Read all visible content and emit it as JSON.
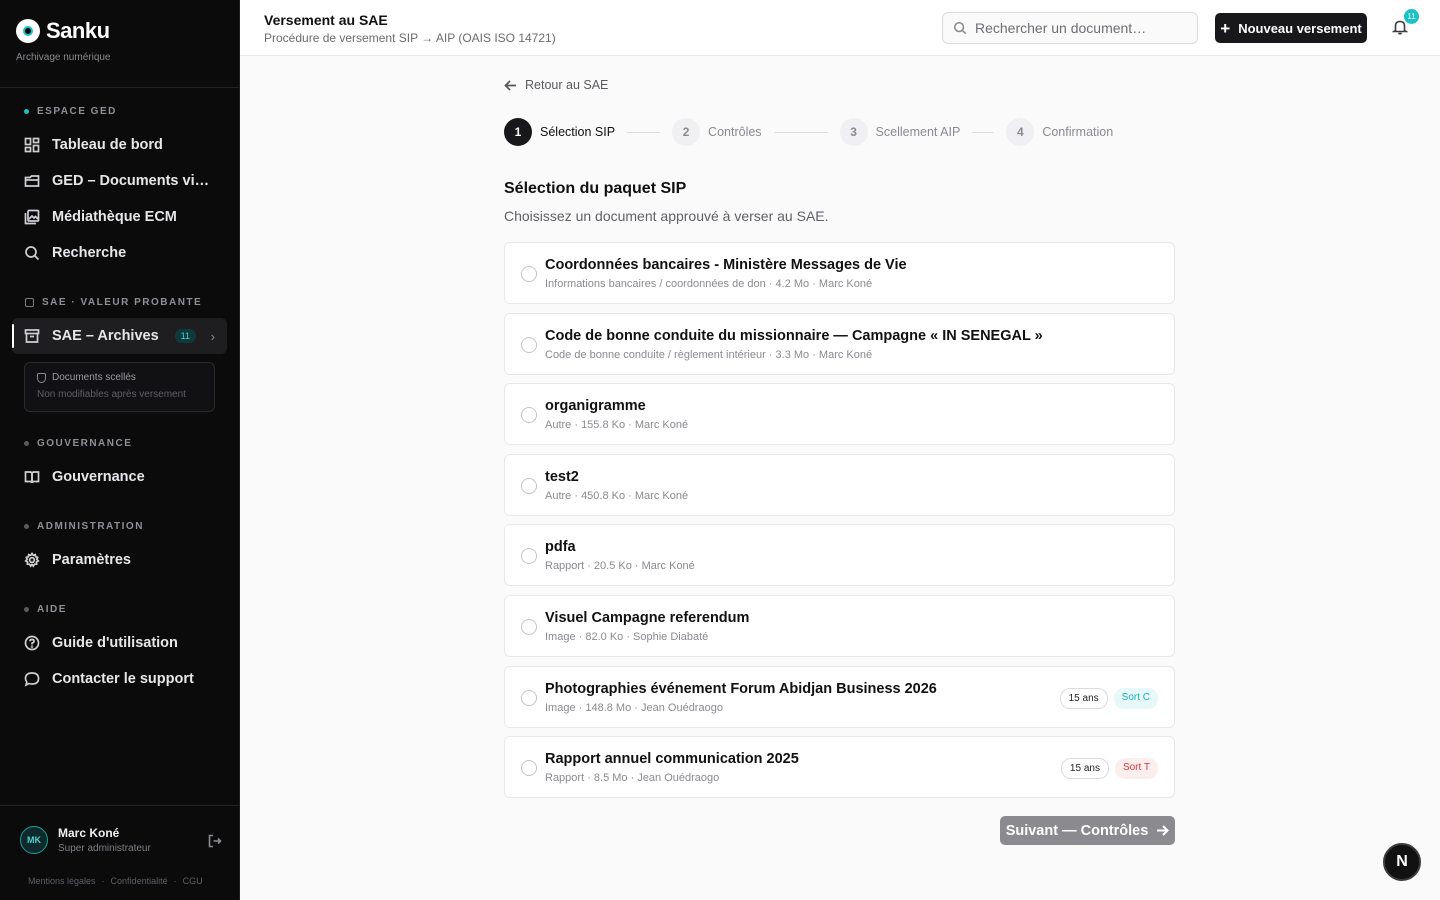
{
  "brand": {
    "name": "Sanku",
    "subtitle": "Archivage numérique"
  },
  "sidebar": {
    "sections": [
      {
        "title": "ESPACE GED"
      },
      {
        "title": "SAE · VALEUR PROBANTE"
      },
      {
        "title": "GOUVERNANCE"
      },
      {
        "title": "ADMINISTRATION"
      },
      {
        "title": "AIDE"
      }
    ],
    "items": [
      {
        "label": "Tableau de bord",
        "icon": "dashboard-icon"
      },
      {
        "label": "GED – Documents vivants",
        "icon": "folder-icon"
      },
      {
        "label": "Médiathèque ECM",
        "icon": "media-icon"
      },
      {
        "label": "Recherche",
        "icon": "search-icon"
      },
      {
        "label": "SAE – Archives",
        "icon": "archive-icon",
        "badge": "11"
      },
      {
        "label": "Gouvernance",
        "icon": "book-icon"
      },
      {
        "label": "Paramètres",
        "icon": "gear-icon"
      },
      {
        "label": "Guide d'utilisation",
        "icon": "help-icon"
      },
      {
        "label": "Contacter le support",
        "icon": "chat-icon"
      }
    ],
    "sealed": {
      "title": "Documents scellés",
      "subtitle": "Non modifiables après versement"
    },
    "user": {
      "initials": "MK",
      "name": "Marc Koné",
      "role": "Super administrateur"
    },
    "footer": [
      "Mentions légales",
      "·",
      "Confidentialité",
      "·",
      "CGU"
    ]
  },
  "header": {
    "title": "Versement au SAE",
    "subtitle": "Procédure de versement SIP → AIP (OAIS ISO 14721)",
    "search_placeholder": "Rechercher un document…",
    "new_button": "Nouveau versement",
    "notifications": "11"
  },
  "main": {
    "back": "Retour au SAE",
    "steps": [
      {
        "num": "1",
        "label": "Sélection SIP"
      },
      {
        "num": "2",
        "label": "Contrôles"
      },
      {
        "num": "3",
        "label": "Scellement AIP"
      },
      {
        "num": "4",
        "label": "Confirmation"
      }
    ],
    "title": "Sélection du paquet SIP",
    "subtitle": "Choisissez un document approuvé à verser au SAE.",
    "documents": [
      {
        "title": "Coordonnées bancaires - Ministère Messages de Vie",
        "meta": "Informations bancaires / coordonnées de don · 4.2 Mo · Marc Koné"
      },
      {
        "title": "Code de bonne conduite du missionnaire — Campagne « IN SENEGAL »",
        "meta": "Code de bonne conduite / règlement intérieur · 3.3 Mo · Marc Koné"
      },
      {
        "title": "organigramme",
        "meta": "Autre · 155.8 Ko · Marc Koné"
      },
      {
        "title": "test2",
        "meta": "Autre · 450.8 Ko · Marc Koné"
      },
      {
        "title": "pdfa",
        "meta": "Rapport · 20.5 Ko · Marc Koné"
      },
      {
        "title": "Visuel Campagne referendum",
        "meta": "Image · 82.0 Ko · Sophie Diabaté"
      },
      {
        "title": "Photographies événement Forum Abidjan Business 2026",
        "meta": "Image · 148.8 Mo · Jean Ouédraogo",
        "duration": "15 ans",
        "sort": "Sort C"
      },
      {
        "title": "Rapport annuel communication 2025",
        "meta": "Rapport · 8.5 Mo · Jean Ouédraogo",
        "duration": "15 ans",
        "sort": "Sort T"
      }
    ],
    "next_button": "Suivant — Contrôles",
    "fab": "N"
  }
}
